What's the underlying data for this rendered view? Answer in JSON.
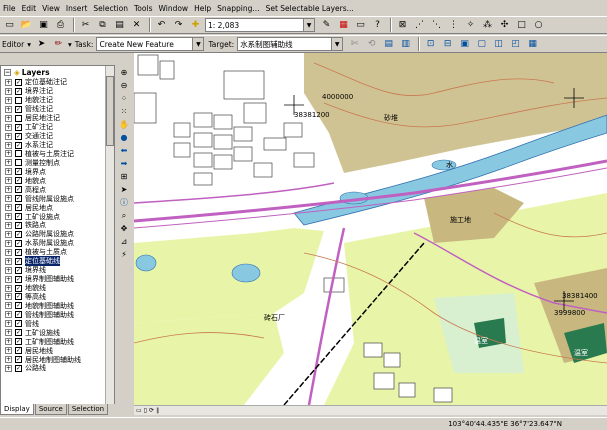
{
  "menu": [
    "File",
    "Edit",
    "View",
    "Insert",
    "Selection",
    "Tools",
    "Window",
    "Help",
    "Snapping...",
    "Set Selectable Layers..."
  ],
  "toolbar": {
    "scale": "1: 2,083",
    "editor_label": "Editor",
    "task_label": "Task:",
    "task_value": "Create New Feature",
    "target_label": "Target:",
    "target_value": "水系制图辅助线"
  },
  "toc": {
    "title": "Layers",
    "layers": [
      {
        "name": "定位基础注记",
        "checked": true
      },
      {
        "name": "境界注记",
        "checked": true
      },
      {
        "name": "地貌注记",
        "checked": false
      },
      {
        "name": "管线注记",
        "checked": true
      },
      {
        "name": "居民地注记",
        "checked": false
      },
      {
        "name": "工矿注记",
        "checked": true
      },
      {
        "name": "交通注记",
        "checked": true
      },
      {
        "name": "水系注记",
        "checked": true
      },
      {
        "name": "植被与土质注记",
        "checked": false
      },
      {
        "name": "测量控制点",
        "checked": false
      },
      {
        "name": "境界点",
        "checked": true
      },
      {
        "name": "地貌点",
        "checked": true
      },
      {
        "name": "高程点",
        "checked": true
      },
      {
        "name": "管线附属设施点",
        "checked": true
      },
      {
        "name": "居民地点",
        "checked": true
      },
      {
        "name": "工矿设施点",
        "checked": true
      },
      {
        "name": "铁路点",
        "checked": true
      },
      {
        "name": "公路附属设施点",
        "checked": true
      },
      {
        "name": "水系附属设施点",
        "checked": true
      },
      {
        "name": "植被与土质点",
        "checked": true
      },
      {
        "name": "定位基础线",
        "checked": true,
        "selected": true
      },
      {
        "name": "境界线",
        "checked": true
      },
      {
        "name": "境界制图辅助线",
        "checked": true
      },
      {
        "name": "地貌线",
        "checked": true
      },
      {
        "name": "等高线",
        "checked": true
      },
      {
        "name": "地貌制图辅助线",
        "checked": true
      },
      {
        "name": "管线制图辅助线",
        "checked": true
      },
      {
        "name": "管线",
        "checked": true
      },
      {
        "name": "工矿设施线",
        "checked": true
      },
      {
        "name": "工矿制图辅助线",
        "checked": true
      },
      {
        "name": "居民地线",
        "checked": true
      },
      {
        "name": "居民地制图辅助线",
        "checked": true
      },
      {
        "name": "公路线",
        "checked": true
      }
    ],
    "tabs": [
      "Display",
      "Source",
      "Selection"
    ]
  },
  "map": {
    "labels": [
      "4000000",
      "38381200",
      "砂堆",
      "水",
      "施工地",
      "砖石厂",
      "38381400",
      "3999800",
      "温室",
      "温室"
    ]
  },
  "status": {
    "coords": "103°40'44.435\"E  36°7'23.647\"N"
  },
  "colors": {
    "green": "#e8f5a8",
    "brown": "#d8c898",
    "water": "#88c8e0",
    "road": "#c060c0",
    "contour": "#c87850"
  }
}
